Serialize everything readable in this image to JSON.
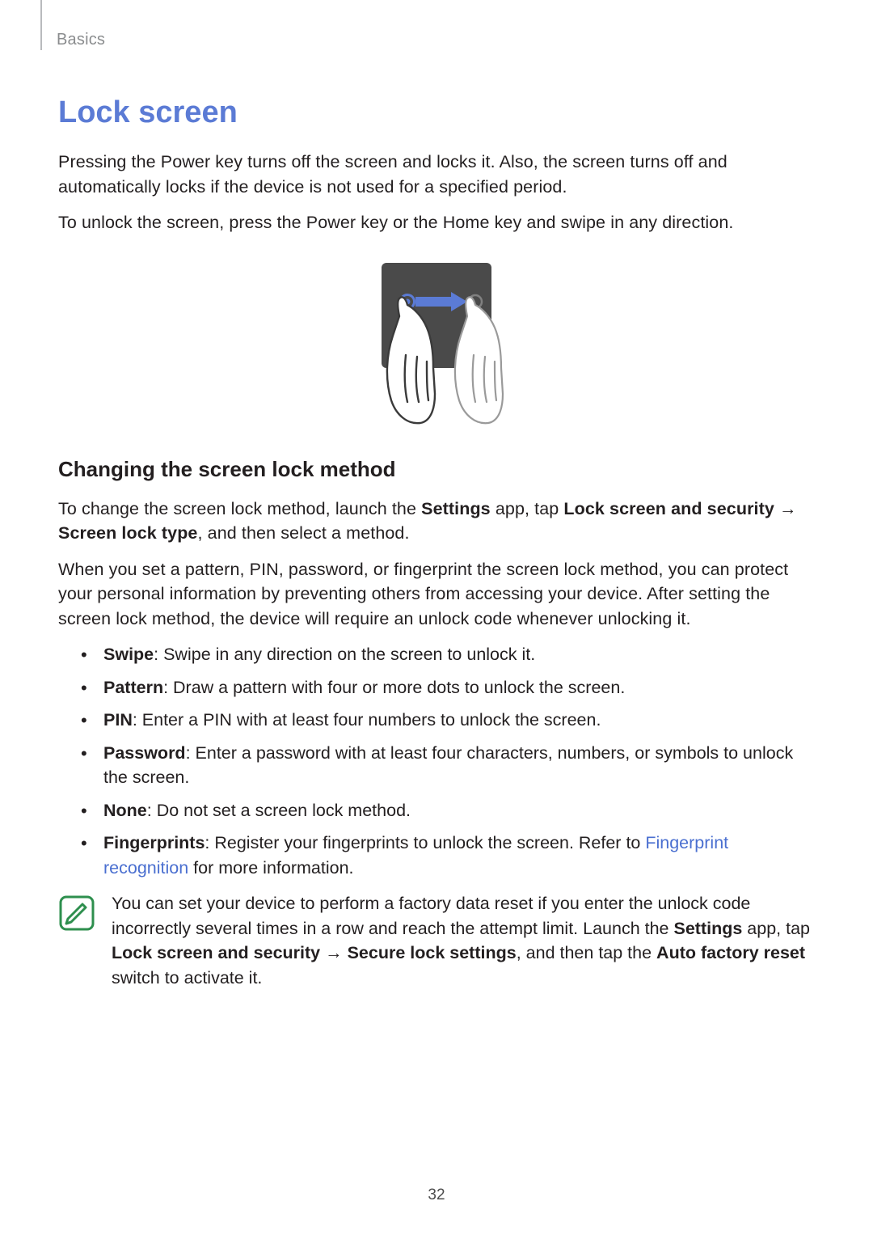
{
  "breadcrumb": "Basics",
  "title": "Lock screen",
  "intro1": "Pressing the Power key turns off the screen and locks it. Also, the screen turns off and automatically locks if the device is not used for a specified period.",
  "intro2": "To unlock the screen, press the Power key or the Home key and swipe in any direction.",
  "h2": "Changing the screen lock method",
  "change": {
    "prefix": "To change the screen lock method, launch the ",
    "settings": "Settings",
    "mid1": " app, tap ",
    "path1": "Lock screen and security",
    "arrow": " → ",
    "path2": "Screen lock type",
    "suffix": ", and then select a method."
  },
  "protect": "When you set a pattern, PIN, password, or fingerprint the screen lock method, you can protect your personal information by preventing others from accessing your device. After setting the screen lock method, the device will require an unlock code whenever unlocking it.",
  "items": [
    {
      "name": "Swipe",
      "desc": ": Swipe in any direction on the screen to unlock it."
    },
    {
      "name": "Pattern",
      "desc": ": Draw a pattern with four or more dots to unlock the screen."
    },
    {
      "name": "PIN",
      "desc": ": Enter a PIN with at least four numbers to unlock the screen."
    },
    {
      "name": "Password",
      "desc": ": Enter a password with at least four characters, numbers, or symbols to unlock the screen."
    },
    {
      "name": "None",
      "desc": ": Do not set a screen lock method."
    }
  ],
  "fp": {
    "name": "Fingerprints",
    "pre": ": Register your fingerprints to unlock the screen. Refer to ",
    "link": "Fingerprint recognition",
    "post": " for more information."
  },
  "note": {
    "t1": "You can set your device to perform a factory data reset if you enter the unlock code incorrectly several times in a row and reach the attempt limit. Launch the ",
    "b1": "Settings",
    "t2": " app, tap ",
    "b2": "Lock screen and security",
    "arrow": " → ",
    "b3": "Secure lock settings",
    "t3": ", and then tap the ",
    "b4": "Auto factory reset",
    "t4": " switch to activate it."
  },
  "pageNumber": "32"
}
